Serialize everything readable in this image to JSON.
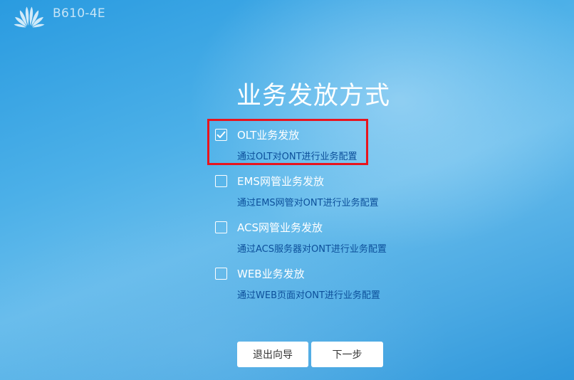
{
  "header": {
    "logo_icon": "huawei-logo-icon",
    "model": "B610-4E"
  },
  "main": {
    "title": "业务发放方式",
    "options": [
      {
        "label": "OLT业务发放",
        "description": "通过OLT对ONT进行业务配置",
        "checked": true
      },
      {
        "label": "EMS网管业务发放",
        "description": "通过EMS网管对ONT进行业务配置",
        "checked": false
      },
      {
        "label": "ACS网管业务发放",
        "description": "通过ACS服务器对ONT进行业务配置",
        "checked": false
      },
      {
        "label": "WEB业务发放",
        "description": "通过WEB页面对ONT进行业务配置",
        "checked": false
      }
    ]
  },
  "buttons": {
    "exit_label": "退出向导",
    "next_label": "下一步"
  },
  "colors": {
    "background": "#4cb0e8",
    "description_text": "#0c4f9a",
    "highlight": "#e8141e"
  }
}
